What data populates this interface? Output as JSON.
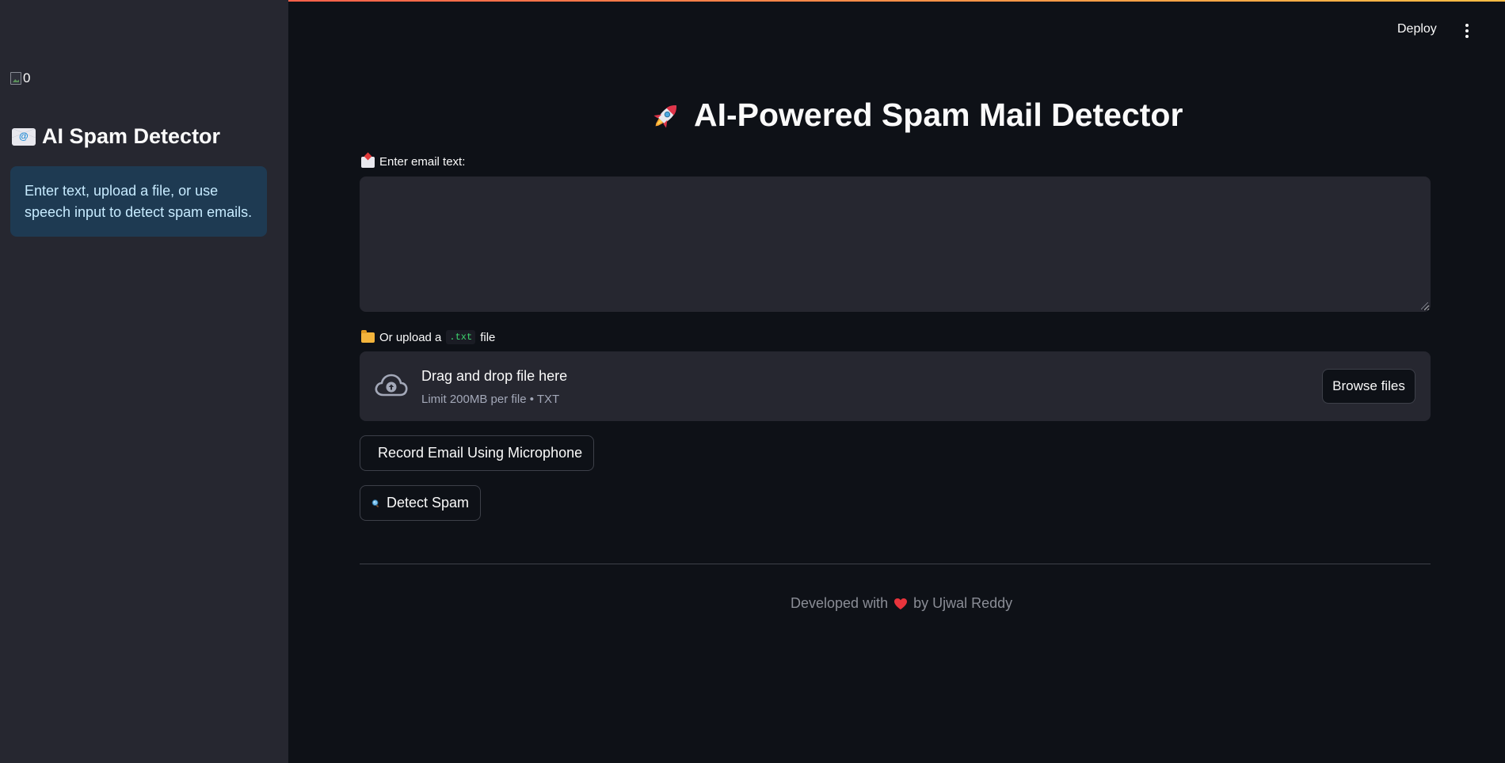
{
  "header": {
    "deploy_label": "Deploy",
    "menu_icon": "kebab-menu-icon"
  },
  "sidebar": {
    "image_alt": "0",
    "title": "AI Spam Detector",
    "title_icon": "envelope-icon",
    "info_text": "Enter text, upload a file, or use speech input to detect spam emails."
  },
  "main": {
    "title": "AI-Powered Spam Mail Detector",
    "title_icon": "rocket-icon",
    "email_input": {
      "label": "Enter email text:",
      "label_icon": "incoming-mail-icon",
      "value": "",
      "placeholder": ""
    },
    "upload": {
      "label_prefix": "Or upload a",
      "label_code": ".txt",
      "label_suffix": "file",
      "label_icon": "folder-icon",
      "drop_title": "Drag and drop file here",
      "drop_subtitle": "Limit 200MB per file • TXT",
      "browse_label": "Browse files"
    },
    "record_button_label": "Record Email Using Microphone",
    "detect_button_label": "Detect Spam"
  },
  "footer": {
    "prefix": "Developed with",
    "suffix": "by Ujwal Reddy",
    "icon": "heart-icon"
  },
  "colors": {
    "background": "#0e1117",
    "sidebar": "#262730",
    "info_box": "#1e3a52",
    "info_text": "#c7ebff",
    "accent_line": "#ff4b4b"
  }
}
